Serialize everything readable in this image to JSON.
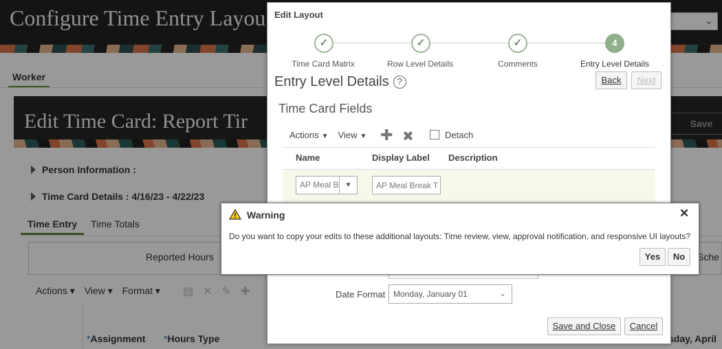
{
  "page": {
    "title": "Configure Time Entry Layou",
    "worker_tab": "Worker",
    "banner_title": "Edit Time Card: Report Tir",
    "banner_save": "Save",
    "person_information": "Person Information :",
    "time_card_details": "Time Card Details : 4/16/23 - 4/22/23",
    "tabs": [
      "Time Entry",
      "Time Totals"
    ],
    "reported_hours": "Reported Hours",
    "schedule_partial": "Sche",
    "toolbar": {
      "actions": "Actions ▾",
      "view": "View ▾",
      "format": "Format ▾"
    },
    "columns": {
      "assignment": "Assignment",
      "hours_type": "Hours Type",
      "day_partial": "sday, April"
    }
  },
  "dialog": {
    "title": "Edit Layout",
    "steps": [
      {
        "label": "Time Card Matrix",
        "state": "done"
      },
      {
        "label": "Row Level Details",
        "state": "done"
      },
      {
        "label": "Comments",
        "state": "done"
      },
      {
        "label": "Entry Level Details",
        "state": "current",
        "number": "4"
      }
    ],
    "section_title": "Entry Level Details",
    "back_label": "Back",
    "next_label": "Next",
    "sub_title": "Time Card Fields",
    "toolbar": {
      "actions": "Actions",
      "view": "View",
      "detach": "Detach"
    },
    "table": {
      "headers": [
        "Name",
        "Display Label",
        "Description"
      ],
      "row": {
        "name": "AP Meal Br",
        "display_label": "AP Meal Break T"
      }
    },
    "date_format_label": "Date Format",
    "date_format_value": "Monday, January 01",
    "save_close_label": "Save and Close",
    "cancel_label": "Cancel"
  },
  "warning": {
    "title": "Warning",
    "message": "Do you want to copy your edits to these additional layouts: Time review, view, approval notification, and responsive UI layouts?",
    "yes_label": "Yes",
    "no_label": "No",
    "icon_color": "#f5c518"
  }
}
